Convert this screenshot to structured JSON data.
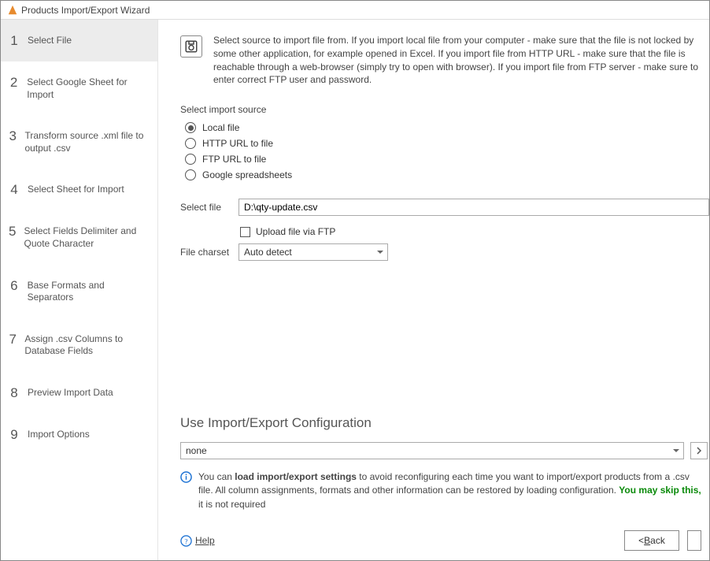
{
  "window": {
    "title": "Products Import/Export Wizard"
  },
  "sidebar": {
    "steps": [
      {
        "num": "1",
        "label": "Select File",
        "active": true
      },
      {
        "num": "2",
        "label": "Select Google Sheet for Import"
      },
      {
        "num": "3",
        "label": "Transform source .xml file to output .csv"
      },
      {
        "num": "4",
        "label": "Select Sheet for Import"
      },
      {
        "num": "5",
        "label": "Select Fields Delimiter and Quote Character"
      },
      {
        "num": "6",
        "label": "Base Formats and Separators"
      },
      {
        "num": "7",
        "label": "Assign .csv Columns to Database Fields"
      },
      {
        "num": "8",
        "label": "Preview Import Data"
      },
      {
        "num": "9",
        "label": "Import Options"
      }
    ]
  },
  "main": {
    "info_text": "Select source to import file from. If you import local file from your computer - make sure that the file is not locked by some other application, for example opened in Excel. If you import file from HTTP URL - make sure that the file is reachable through a web-browser (simply try to open with browser). If you import file from FTP server - make sure to enter correct FTP user and password.",
    "source_label": "Select import source",
    "sources": [
      {
        "label": "Local file",
        "selected": true
      },
      {
        "label": "HTTP URL to file",
        "selected": false
      },
      {
        "label": "FTP URL to file",
        "selected": false
      },
      {
        "label": "Google spreadsheets",
        "selected": false
      }
    ],
    "select_file_label": "Select file",
    "select_file_value": "D:\\qty-update.csv",
    "upload_ftp_label": "Upload file via FTP",
    "upload_ftp_checked": false,
    "charset_label": "File charset",
    "charset_value": "Auto detect",
    "config_heading": "Use Import/Export Configuration",
    "config_value": "none",
    "tip_prefix": "You can ",
    "tip_bold": "load import/export settings",
    "tip_mid": " to avoid reconfiguring each time you want to import/export products from a .csv file. All column assignments, formats and other information can be restored by loading configuration. ",
    "tip_green": "You may skip this,",
    "tip_suffix": " it is not required"
  },
  "footer": {
    "help": "Help",
    "back_prefix": "< ",
    "back_u": "B",
    "back_suffix": "ack"
  }
}
